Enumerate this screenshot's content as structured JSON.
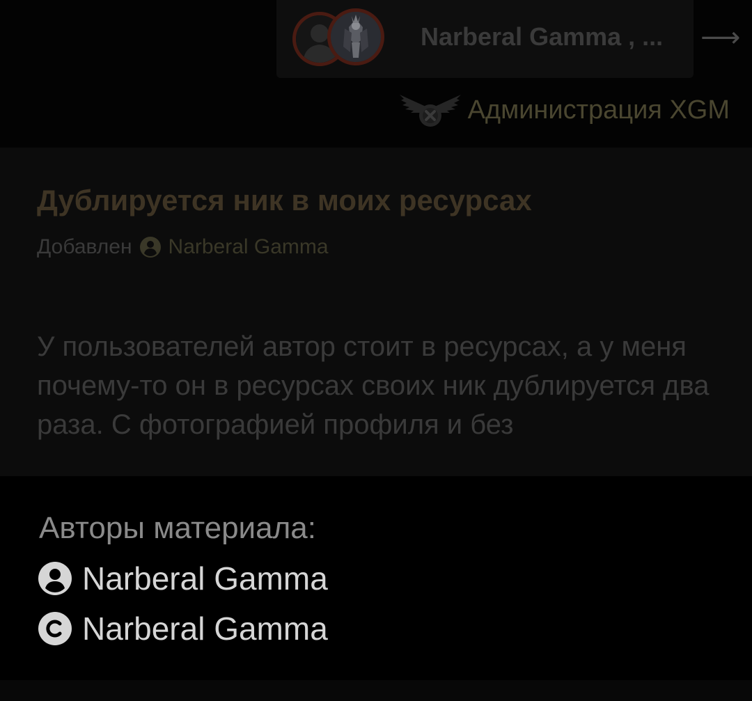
{
  "header": {
    "chat_names": "Narberal Gamma , ...",
    "arrow_glyph": "⟶",
    "admin_label": "Администрация XGM",
    "avatar_ring_color": "#4a1b12"
  },
  "post": {
    "title": "Дублируется ник в моих ресурсах",
    "added_label": "Добавлен",
    "added_author": "Narberal Gamma",
    "body": "У пользователей автор стоит в ресурсах, а у меня почему-то он в ресурсах своих ник дублируется два раза. С фотографией профиля и без"
  },
  "authors_panel": {
    "title": "Авторы материала:",
    "authors": [
      {
        "icon": "user-circle-icon",
        "name": "Narberal Gamma"
      },
      {
        "icon": "copyright-icon",
        "name": "Narberal Gamma"
      }
    ]
  },
  "colors": {
    "title_color": "#3e3424",
    "author_link_color": "#3a3828",
    "panel_text": "#d6d6d6"
  }
}
